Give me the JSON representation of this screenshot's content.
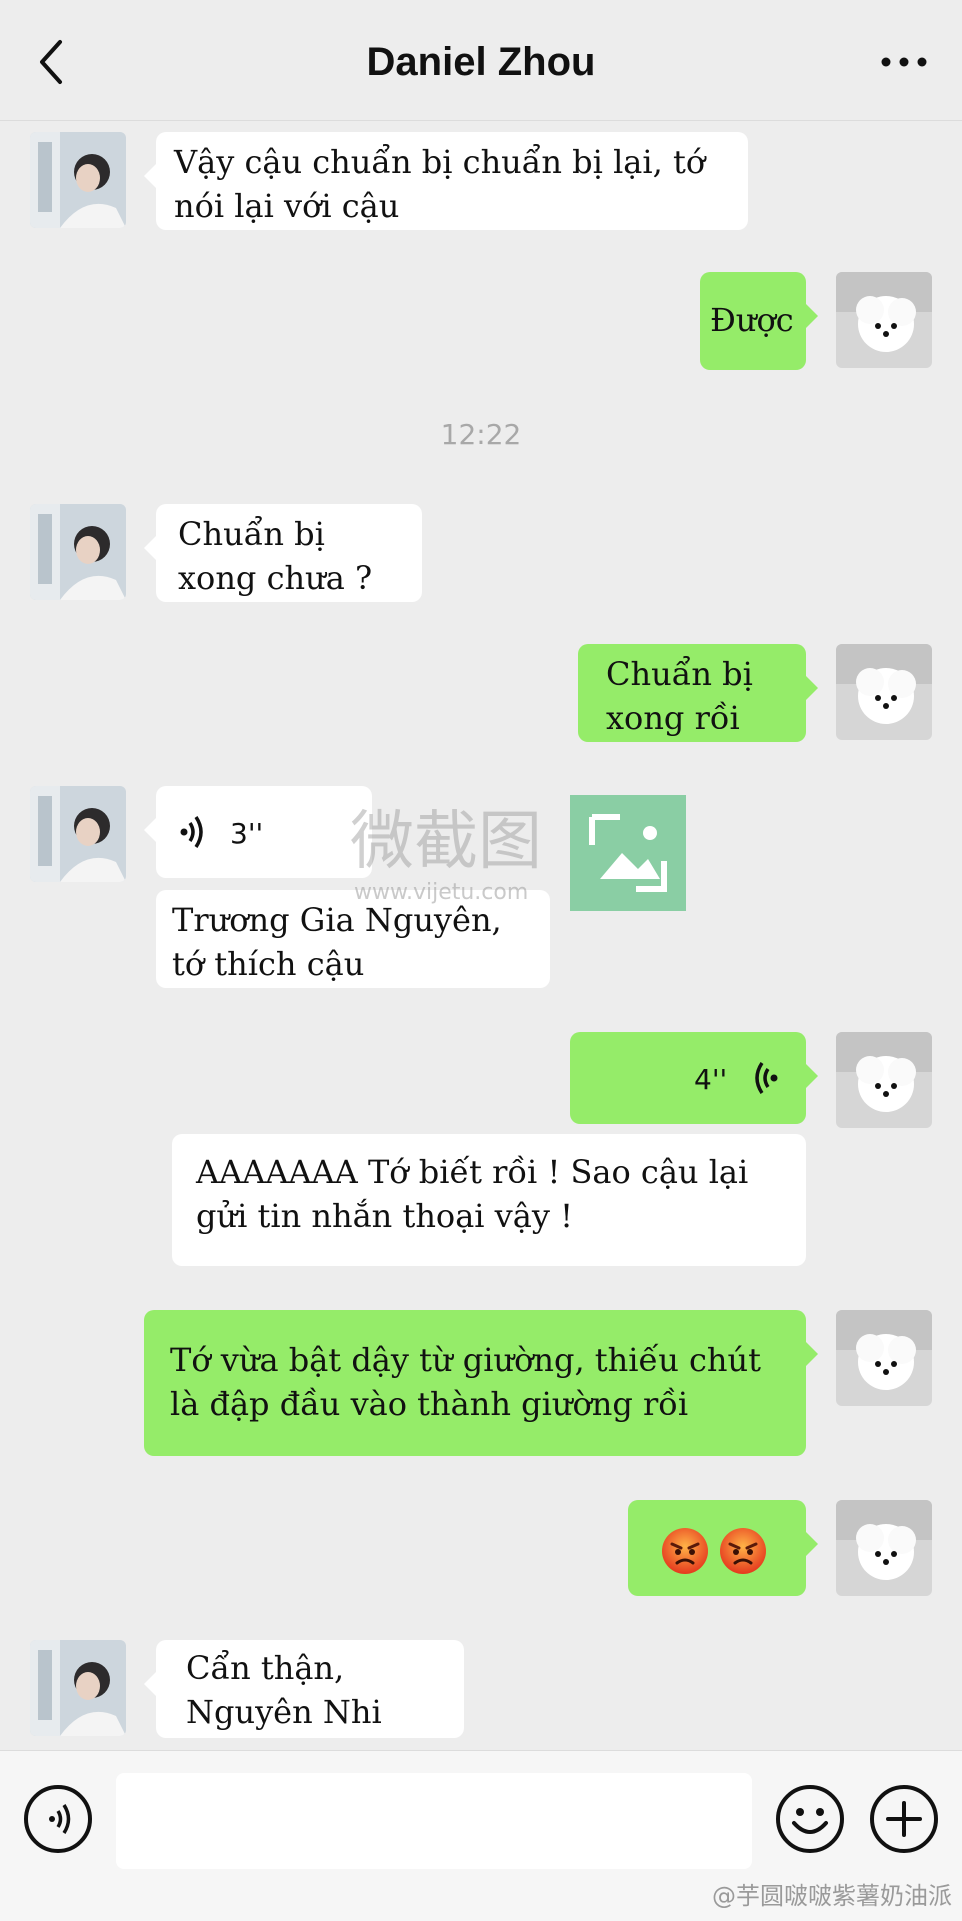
{
  "header": {
    "title": "Daniel Zhou"
  },
  "timestamp": "12:22",
  "messages": {
    "m1": "Vậy cậu chuẩn bị chuẩn bị lại, tớ nói lại với cậu",
    "m2": "Được",
    "m3": "Chuẩn bị xong chưa ?",
    "m4": "Chuẩn bị xong rồi",
    "m5_voice": "3''",
    "m6": "Trương Gia Nguyên, tớ thích cậu",
    "m7_voice": "4''",
    "m8": "AAAAAAA Tớ biết rồi ! Sao cậu lại gửi tin nhắn thoại vậy !",
    "m9": "Tớ vừa bật dậy từ giường, thiếu chút là đập đầu vào thành giường rồi",
    "m10": "😡😡",
    "m11": "Cẩn thận, Nguyên Nhi"
  },
  "watermark": {
    "text": "微截图",
    "url": "www.vijetu.com"
  },
  "footer": {
    "credit": "@芋圆啵啵紫薯奶油派"
  },
  "colors": {
    "incoming": "#ffffff",
    "outgoing": "#95ec69",
    "background": "#ededed"
  }
}
